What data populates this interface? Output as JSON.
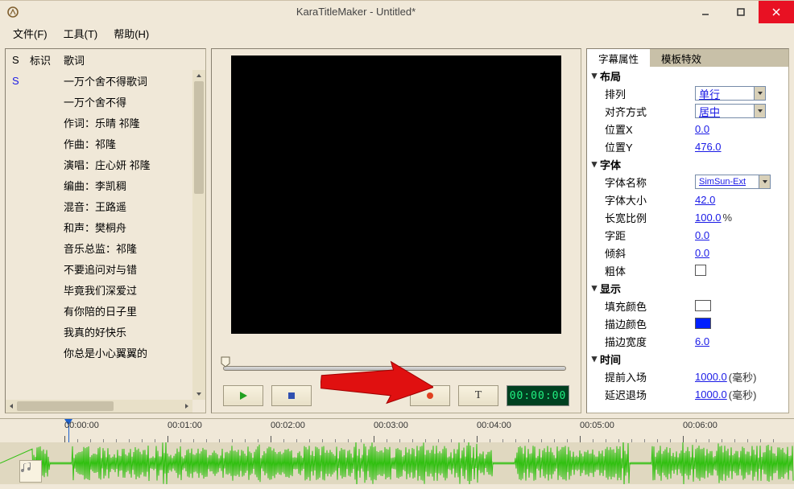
{
  "window": {
    "title": "KaraTitleMaker - Untitled*"
  },
  "menu": {
    "file": "文件(F)",
    "tools": "工具(T)",
    "help": "帮助(H)"
  },
  "lyrics": {
    "cols": {
      "s": "S",
      "mark": "标识",
      "lyric": "歌词"
    },
    "rows": [
      {
        "s": "S",
        "text": "一万个舍不得歌词"
      },
      {
        "s": "",
        "text": "一万个舍不得"
      },
      {
        "s": "",
        "text": "作词：乐晴 祁隆"
      },
      {
        "s": "",
        "text": "作曲：祁隆"
      },
      {
        "s": "",
        "text": "演唱：庄心妍 祁隆"
      },
      {
        "s": "",
        "text": "编曲：李凯稠"
      },
      {
        "s": "",
        "text": "混音：王路遥"
      },
      {
        "s": "",
        "text": "和声：樊桐舟"
      },
      {
        "s": "",
        "text": "音乐总监：祁隆"
      },
      {
        "s": "",
        "text": "不要追问对与错"
      },
      {
        "s": "",
        "text": "毕竟我们深爱过"
      },
      {
        "s": "",
        "text": "有你陪的日子里"
      },
      {
        "s": "",
        "text": "我真的好快乐"
      },
      {
        "s": "",
        "text": "你总是小心翼翼的"
      }
    ]
  },
  "controls": {
    "time_display": "00:00:00"
  },
  "tabs": {
    "a": "字幕属性",
    "b": "模板特效"
  },
  "props": {
    "group_layout": "布局",
    "layout_arrange": {
      "label": "排列",
      "value": "单行"
    },
    "layout_align": {
      "label": "对齐方式",
      "value": "居中"
    },
    "layout_posx": {
      "label": "位置X",
      "value": "0.0"
    },
    "layout_posy": {
      "label": "位置Y",
      "value": "476.0"
    },
    "group_font": "字体",
    "font_name": {
      "label": "字体名称",
      "value": "SimSun-Ext"
    },
    "font_size": {
      "label": "字体大小",
      "value": "42.0"
    },
    "font_aspect": {
      "label": "长宽比例",
      "value": "100.0",
      "unit": "%"
    },
    "font_spacing": {
      "label": "字距",
      "value": "0.0"
    },
    "font_skew": {
      "label": "倾斜",
      "value": "0.0"
    },
    "font_bold": {
      "label": "粗体"
    },
    "group_display": "显示",
    "fill_color": {
      "label": "填充颜色",
      "value": "#ffffff"
    },
    "stroke_color": {
      "label": "描边颜色",
      "value": "#0020ff"
    },
    "stroke_width": {
      "label": "描边宽度",
      "value": "6.0"
    },
    "group_time": "时间",
    "time_lead": {
      "label": "提前入场",
      "value": "1000.0",
      "unit": "(毫秒)"
    },
    "time_delay": {
      "label": "延迟退场",
      "value": "1000.0",
      "unit": "(毫秒)"
    }
  },
  "timeline": {
    "labels": [
      "00:00:00",
      "00:01:00",
      "00:02:00",
      "00:03:00",
      "00:04:00",
      "00:05:00",
      "00:06:00"
    ]
  }
}
